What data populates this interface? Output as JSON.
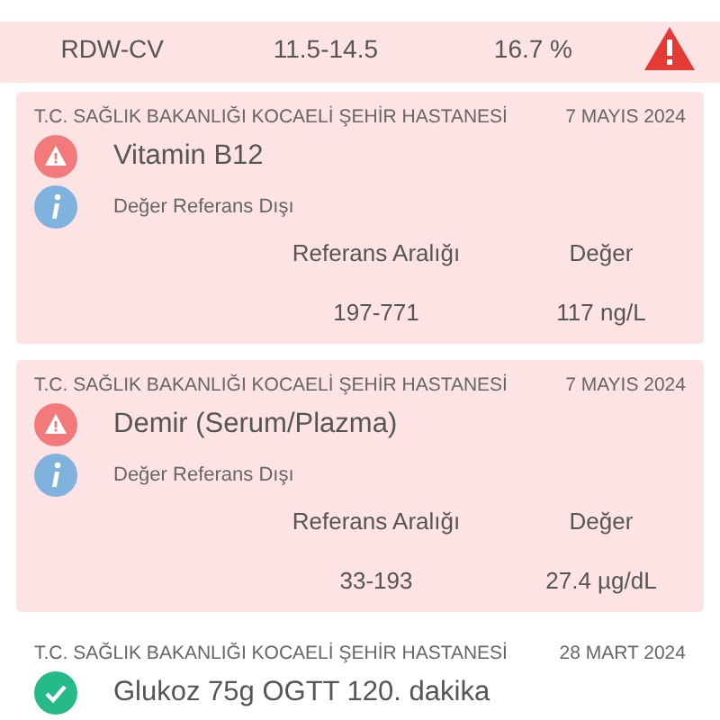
{
  "top_row": {
    "name": "RDW-CV",
    "range": "11.5-14.5",
    "value": "16.7 %",
    "flagged": true
  },
  "results": [
    {
      "hospital": "T.C. SAĞLIK BAKANLIĞI KOCAELİ ŞEHİR HASTANESİ",
      "date": "7 MAYIS 2024",
      "flagged": true,
      "test": "Vitamin B12",
      "note": "Değer Referans Dışı",
      "range_label": "Referans Aralığı",
      "value_label": "Değer",
      "range": "197-771",
      "value": "117 ng/L"
    },
    {
      "hospital": "T.C. SAĞLIK BAKANLIĞI KOCAELİ ŞEHİR HASTANESİ",
      "date": "7 MAYIS 2024",
      "flagged": true,
      "test": "Demir (Serum/Plazma)",
      "note": "Değer Referans Dışı",
      "range_label": "Referans Aralığı",
      "value_label": "Değer",
      "range": "33-193",
      "value": "27.4 µg/dL"
    },
    {
      "hospital": "T.C. SAĞLIK BAKANLIĞI KOCAELİ ŞEHİR HASTANESİ",
      "date": "28 MART 2024",
      "flagged": false,
      "test": "Glukoz 75g OGTT 120. dakika"
    }
  ]
}
